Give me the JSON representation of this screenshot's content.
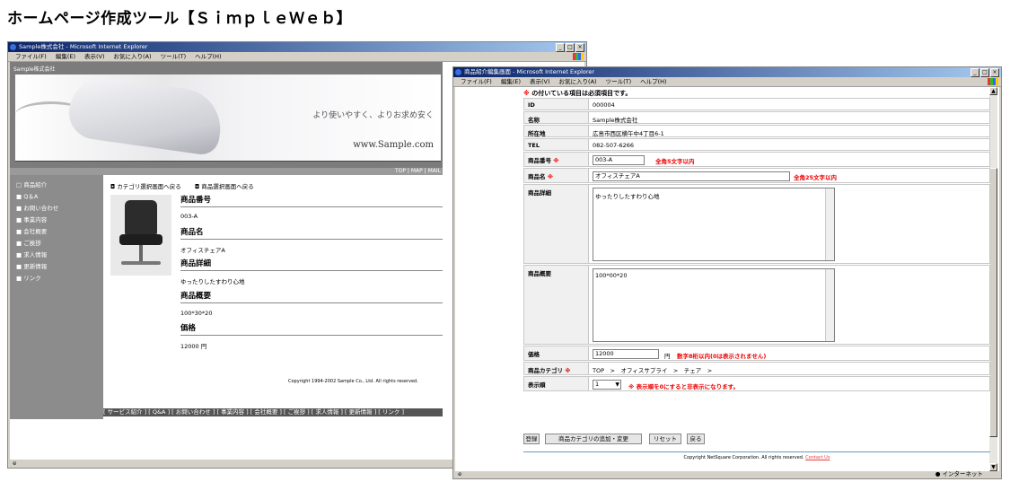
{
  "heading": "ホームページ作成ツール【ＳｉｍｐｌｅＷｅｂ】",
  "left_window": {
    "title": "Sample株式会社 - Microsoft Internet Explorer",
    "menu": [
      "ファイル(F)",
      "編集(E)",
      "表示(V)",
      "お気に入り(A)",
      "ツール(T)",
      "ヘルプ(H)"
    ],
    "company_label": "Sample株式会社",
    "tagline": "より使いやすく、よりお求め安く",
    "site_url": "www.Sample.com",
    "top_nav": "TOP | MAP | MAIL",
    "sidebar": [
      "□ 商品紹介",
      "■ Q＆A",
      "■ お問い合わせ",
      "■ 事業内容",
      "■ 会社概要",
      "■ ご挨拶",
      "■ 求人情報",
      "■ 更新情報",
      "■ リンク"
    ],
    "breadcrumb_category": "◘ カテゴリ選択画面へ戻る",
    "breadcrumb_product": "◘ 商品選択画面へ戻る",
    "fields": [
      {
        "label": "商品番号",
        "value": "003-A"
      },
      {
        "label": "商品名",
        "value": "オフィスチェアA"
      },
      {
        "label": "商品詳細",
        "value": "ゆったりしたすわり心地"
      },
      {
        "label": "商品概要",
        "value": "100*30*20"
      },
      {
        "label": "価格",
        "value": "12000 円"
      }
    ],
    "footer_nav": "[ サービス紹介 ] [ Q&A ] [ お問い合わせ ] [ 事業内容 ] [ 会社概要 ] [ ご挨拶 ] [ 求人情報 ] [ 更新情報 ] [ リンク ]",
    "copyright": "Copyright 1994-2002 Sample Co., Ltd. All rights reserved."
  },
  "right_window": {
    "title": "商品紹介編集画面 - Microsoft Internet Explorer",
    "menu": [
      "ファイル(F)",
      "編集(E)",
      "表示(V)",
      "お気に入り(A)",
      "ツール(T)",
      "ヘルプ(H)"
    ],
    "required_note": "の付いている項目は必須項目です。",
    "required_mark": "※",
    "rows": [
      {
        "label": "ID",
        "value": "000004"
      },
      {
        "label": "名称",
        "value": "Sample株式会社"
      },
      {
        "label": "所在地",
        "value": "広島市西区横午中4丁目6-1"
      },
      {
        "label": "TEL",
        "value": "082-507-6266"
      }
    ],
    "product_no": {
      "label": "商品番号",
      "value": "003-A",
      "hint": "全角5文字以内"
    },
    "product_name": {
      "label": "商品名",
      "value": "オフィスチェアA",
      "hint": "全角25文字以内"
    },
    "product_detail": {
      "label": "商品詳細",
      "value": "ゆったりしたすわり心地"
    },
    "product_summary": {
      "label": "商品概要",
      "value": "100*00*20"
    },
    "price": {
      "label": "価格",
      "value": "12000",
      "unit": "円",
      "hint": "数字8桁以内(0は表示されません)"
    },
    "category": {
      "label": "商品カテゴリ",
      "value": "TOP　>　オフィスサプライ　>　チェア　>"
    },
    "display_order": {
      "label": "表示順",
      "value": "1",
      "hint": "※ 表示順を0にすると非表示になります。"
    },
    "buttons": {
      "register": "登録",
      "add_category": "商品カテゴリの追加・変更",
      "reset": "リセット",
      "back": "戻る"
    },
    "copyright": "Copyright NetSquare Corporation. All rights reserved.",
    "contact": "Contact Us",
    "status_zone": "インターネット"
  }
}
